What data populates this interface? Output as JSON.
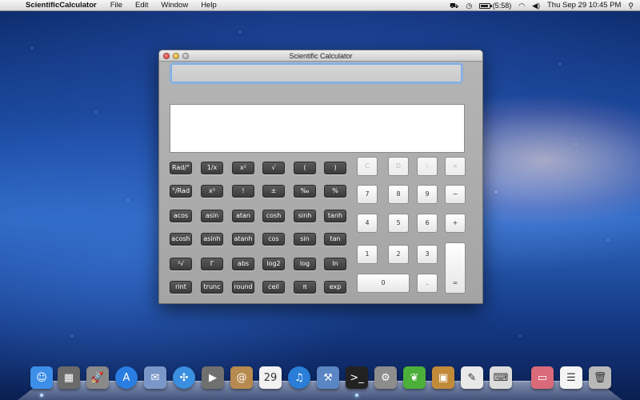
{
  "menubar": {
    "app_name": "ScientificCalculator",
    "menus": [
      "File",
      "Edit",
      "Window",
      "Help"
    ],
    "battery_text": "(5:58)",
    "clock": "Thu Sep 29  10:45 PM"
  },
  "window": {
    "title": "Scientific Calculator",
    "input_value": "",
    "output_value": ""
  },
  "function_buttons": [
    [
      "Rad/°",
      "1/x",
      "x²",
      "√",
      "(",
      ")"
    ],
    [
      "°/Rad",
      "x³",
      "!",
      "±",
      "‰",
      "%"
    ],
    [
      "acos",
      "asin",
      "atan",
      "cosh",
      "sinh",
      "tanh"
    ],
    [
      "acosh",
      "asinh",
      "atanh",
      "cos",
      "sin",
      "tan"
    ],
    [
      "³√",
      "Γ",
      "abs",
      "log2",
      "log",
      "ln"
    ],
    [
      "rint",
      "trunc",
      "round",
      "ceil",
      "π",
      "exp"
    ]
  ],
  "keypad": {
    "row1": [
      "C",
      "D",
      "\\",
      "×"
    ],
    "row2": [
      "7",
      "8",
      "9",
      "−"
    ],
    "row3": [
      "4",
      "5",
      "6",
      "+"
    ],
    "row4": [
      "1",
      "2",
      "3"
    ],
    "zero": "0",
    "dot": ".",
    "equals": "="
  },
  "dock": {
    "items": [
      {
        "name": "finder-icon",
        "glyph": "☺",
        "color": "#3d8ee8"
      },
      {
        "name": "dashboard-icon",
        "glyph": "▦",
        "color": "#6b6b6b"
      },
      {
        "name": "launchpad-icon",
        "glyph": "🚀",
        "color": "#8a8a8a"
      },
      {
        "name": "app-store-icon",
        "glyph": "A",
        "color": "#2a7de1"
      },
      {
        "name": "mail-icon",
        "glyph": "✉",
        "color": "#7b97c9"
      },
      {
        "name": "safari-icon",
        "glyph": "✣",
        "color": "#3b8fe0"
      },
      {
        "name": "facetime-icon",
        "glyph": "▶",
        "color": "#707070"
      },
      {
        "name": "address-book-icon",
        "glyph": "@",
        "color": "#b78a4f"
      },
      {
        "name": "calendar-icon",
        "glyph": "29",
        "color": "#f2f2f2"
      },
      {
        "name": "itunes-icon",
        "glyph": "♫",
        "color": "#2a7ed8"
      },
      {
        "name": "xcode-icon",
        "glyph": "⚒",
        "color": "#5a86c4"
      },
      {
        "name": "terminal-icon",
        "glyph": ">_",
        "color": "#222222"
      },
      {
        "name": "system-preferences-icon",
        "glyph": "⚙",
        "color": "#8d8d8d"
      },
      {
        "name": "leaf-app-icon",
        "glyph": "❦",
        "color": "#4caf3a"
      },
      {
        "name": "installer-icon",
        "glyph": "▣",
        "color": "#c28b3a"
      },
      {
        "name": "css-editor-icon",
        "glyph": "✎",
        "color": "#e9e9e9"
      },
      {
        "name": "keyboard-viewer-icon",
        "glyph": "⌨",
        "color": "#dcdcdc"
      },
      {
        "name": "folder-icon",
        "glyph": "▭",
        "color": "#d96a7a"
      },
      {
        "name": "document-icon",
        "glyph": "☰",
        "color": "#f4f4f4"
      },
      {
        "name": "trash-icon",
        "glyph": "🗑",
        "color": "#b8b8b8"
      }
    ]
  }
}
